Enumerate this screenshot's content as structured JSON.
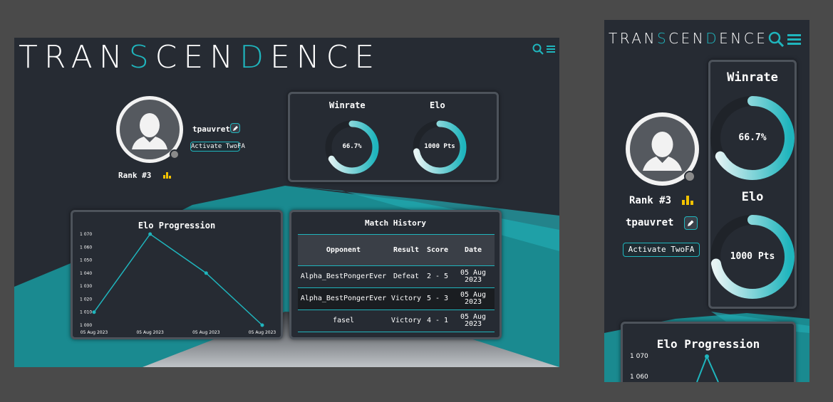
{
  "app": {
    "logo_left": "TRAN",
    "logo_accent": "S",
    "logo_mid": "CEN",
    "logo_accent2": "D",
    "logo_right": "ENCE"
  },
  "icons": {
    "search": "search-icon",
    "menu": "hamburger-menu-icon",
    "edit": "pencil-icon",
    "rank": "podium-icon"
  },
  "colors": {
    "accent": "#1fb5bd",
    "background": "#262b33",
    "panel_border": "#4d535b",
    "rank_icon": "#f2c200"
  },
  "profile": {
    "username": "tpauvret",
    "twofa_label": "Activate TwoFA",
    "rank_label": "Rank #3"
  },
  "stats": {
    "winrate_title": "Winrate",
    "winrate_value": "66.7%",
    "winrate_fraction": 0.667,
    "elo_title": "Elo",
    "elo_value": "1000 Pts",
    "elo_fraction": 0.72
  },
  "elo_chart": {
    "title": "Elo Progression"
  },
  "chart_data": {
    "type": "line",
    "title": "Elo Progression",
    "x": [
      "05 Aug 2023",
      "05 Aug 2023",
      "05 Aug 2023",
      "05 Aug 2023"
    ],
    "series": [
      {
        "values": [
          1010,
          1070,
          1040,
          1000
        ]
      }
    ],
    "ylim": [
      1000,
      1070
    ],
    "yticks": [
      "1 000",
      "1 010",
      "1 020",
      "1 030",
      "1 040",
      "1 050",
      "1 060",
      "1 070"
    ],
    "grid": false
  },
  "match_history": {
    "title": "Match History",
    "columns": [
      "Opponent",
      "Result",
      "Score",
      "Date"
    ],
    "rows": [
      {
        "opponent": "Alpha_BestPongerEver",
        "result": "Defeat",
        "score": "2 - 5",
        "date1": "05 Aug",
        "date2": "2023"
      },
      {
        "opponent": "Alpha_BestPongerEver",
        "result": "Victory",
        "score": "5 - 3",
        "date1": "05 Aug",
        "date2": "2023"
      },
      {
        "opponent": "fasel",
        "result": "Victory",
        "score": "4 - 1",
        "date1": "05 Aug",
        "date2": "2023"
      }
    ]
  },
  "mobile": {
    "ytick_top": "1 070",
    "ytick_second": "1 060"
  }
}
